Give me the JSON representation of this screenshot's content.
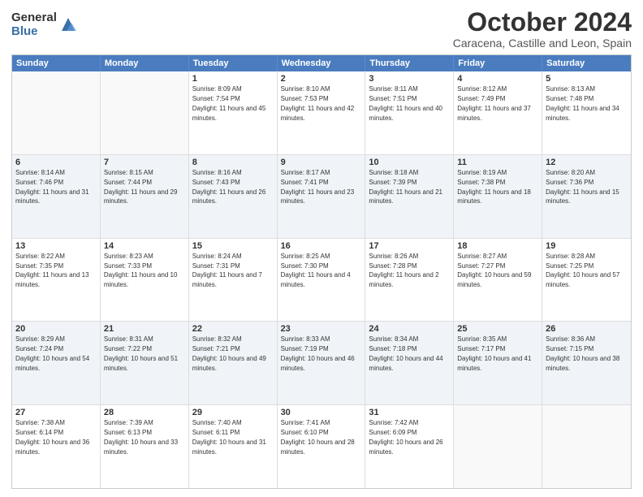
{
  "header": {
    "logo_general": "General",
    "logo_blue": "Blue",
    "title": "October 2024",
    "subtitle": "Caracena, Castille and Leon, Spain"
  },
  "days": [
    "Sunday",
    "Monday",
    "Tuesday",
    "Wednesday",
    "Thursday",
    "Friday",
    "Saturday"
  ],
  "rows": [
    [
      {
        "day": "",
        "text": ""
      },
      {
        "day": "",
        "text": ""
      },
      {
        "day": "1",
        "text": "Sunrise: 8:09 AM\nSunset: 7:54 PM\nDaylight: 11 hours and 45 minutes."
      },
      {
        "day": "2",
        "text": "Sunrise: 8:10 AM\nSunset: 7:53 PM\nDaylight: 11 hours and 42 minutes."
      },
      {
        "day": "3",
        "text": "Sunrise: 8:11 AM\nSunset: 7:51 PM\nDaylight: 11 hours and 40 minutes."
      },
      {
        "day": "4",
        "text": "Sunrise: 8:12 AM\nSunset: 7:49 PM\nDaylight: 11 hours and 37 minutes."
      },
      {
        "day": "5",
        "text": "Sunrise: 8:13 AM\nSunset: 7:48 PM\nDaylight: 11 hours and 34 minutes."
      }
    ],
    [
      {
        "day": "6",
        "text": "Sunrise: 8:14 AM\nSunset: 7:46 PM\nDaylight: 11 hours and 31 minutes."
      },
      {
        "day": "7",
        "text": "Sunrise: 8:15 AM\nSunset: 7:44 PM\nDaylight: 11 hours and 29 minutes."
      },
      {
        "day": "8",
        "text": "Sunrise: 8:16 AM\nSunset: 7:43 PM\nDaylight: 11 hours and 26 minutes."
      },
      {
        "day": "9",
        "text": "Sunrise: 8:17 AM\nSunset: 7:41 PM\nDaylight: 11 hours and 23 minutes."
      },
      {
        "day": "10",
        "text": "Sunrise: 8:18 AM\nSunset: 7:39 PM\nDaylight: 11 hours and 21 minutes."
      },
      {
        "day": "11",
        "text": "Sunrise: 8:19 AM\nSunset: 7:38 PM\nDaylight: 11 hours and 18 minutes."
      },
      {
        "day": "12",
        "text": "Sunrise: 8:20 AM\nSunset: 7:36 PM\nDaylight: 11 hours and 15 minutes."
      }
    ],
    [
      {
        "day": "13",
        "text": "Sunrise: 8:22 AM\nSunset: 7:35 PM\nDaylight: 11 hours and 13 minutes."
      },
      {
        "day": "14",
        "text": "Sunrise: 8:23 AM\nSunset: 7:33 PM\nDaylight: 11 hours and 10 minutes."
      },
      {
        "day": "15",
        "text": "Sunrise: 8:24 AM\nSunset: 7:31 PM\nDaylight: 11 hours and 7 minutes."
      },
      {
        "day": "16",
        "text": "Sunrise: 8:25 AM\nSunset: 7:30 PM\nDaylight: 11 hours and 4 minutes."
      },
      {
        "day": "17",
        "text": "Sunrise: 8:26 AM\nSunset: 7:28 PM\nDaylight: 11 hours and 2 minutes."
      },
      {
        "day": "18",
        "text": "Sunrise: 8:27 AM\nSunset: 7:27 PM\nDaylight: 10 hours and 59 minutes."
      },
      {
        "day": "19",
        "text": "Sunrise: 8:28 AM\nSunset: 7:25 PM\nDaylight: 10 hours and 57 minutes."
      }
    ],
    [
      {
        "day": "20",
        "text": "Sunrise: 8:29 AM\nSunset: 7:24 PM\nDaylight: 10 hours and 54 minutes."
      },
      {
        "day": "21",
        "text": "Sunrise: 8:31 AM\nSunset: 7:22 PM\nDaylight: 10 hours and 51 minutes."
      },
      {
        "day": "22",
        "text": "Sunrise: 8:32 AM\nSunset: 7:21 PM\nDaylight: 10 hours and 49 minutes."
      },
      {
        "day": "23",
        "text": "Sunrise: 8:33 AM\nSunset: 7:19 PM\nDaylight: 10 hours and 46 minutes."
      },
      {
        "day": "24",
        "text": "Sunrise: 8:34 AM\nSunset: 7:18 PM\nDaylight: 10 hours and 44 minutes."
      },
      {
        "day": "25",
        "text": "Sunrise: 8:35 AM\nSunset: 7:17 PM\nDaylight: 10 hours and 41 minutes."
      },
      {
        "day": "26",
        "text": "Sunrise: 8:36 AM\nSunset: 7:15 PM\nDaylight: 10 hours and 38 minutes."
      }
    ],
    [
      {
        "day": "27",
        "text": "Sunrise: 7:38 AM\nSunset: 6:14 PM\nDaylight: 10 hours and 36 minutes."
      },
      {
        "day": "28",
        "text": "Sunrise: 7:39 AM\nSunset: 6:13 PM\nDaylight: 10 hours and 33 minutes."
      },
      {
        "day": "29",
        "text": "Sunrise: 7:40 AM\nSunset: 6:11 PM\nDaylight: 10 hours and 31 minutes."
      },
      {
        "day": "30",
        "text": "Sunrise: 7:41 AM\nSunset: 6:10 PM\nDaylight: 10 hours and 28 minutes."
      },
      {
        "day": "31",
        "text": "Sunrise: 7:42 AM\nSunset: 6:09 PM\nDaylight: 10 hours and 26 minutes."
      },
      {
        "day": "",
        "text": ""
      },
      {
        "day": "",
        "text": ""
      }
    ]
  ]
}
